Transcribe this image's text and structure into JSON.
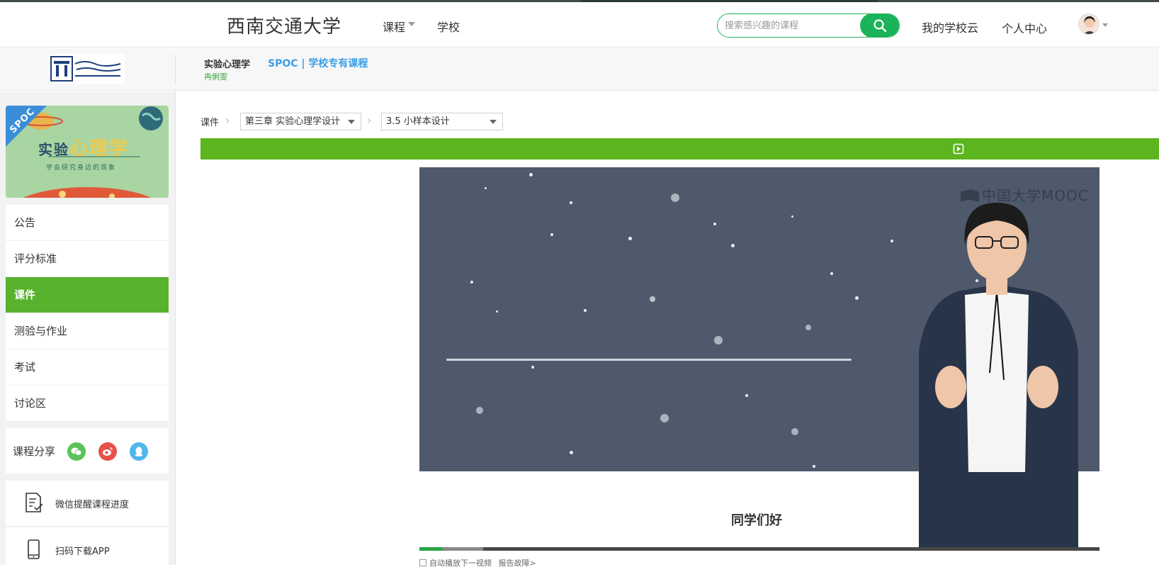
{
  "header": {
    "site_title": "西南交通大学",
    "nav_course": "课程",
    "nav_school": "学校",
    "search_placeholder": "搜索感兴趣的课程",
    "nav_cloud": "我的学校云",
    "nav_personal": "个人中心"
  },
  "course": {
    "name": "实验心理学",
    "badge": "SPOC | 学校专有课程",
    "teacher": "冉俐雯"
  },
  "banner": {
    "corner": "SPOC",
    "title_part1": "实验",
    "title_part2": "心理学",
    "subtitle": "学会研究身边的现象"
  },
  "sidebar": {
    "items": [
      {
        "label": "公告",
        "active": false
      },
      {
        "label": "评分标准",
        "active": false
      },
      {
        "label": "课件",
        "active": true
      },
      {
        "label": "测验与作业",
        "active": false
      },
      {
        "label": "考试",
        "active": false
      },
      {
        "label": "讨论区",
        "active": false
      }
    ],
    "share_label": "课程分享",
    "tool_wechat": "微信提醒课程进度",
    "tool_app": "扫码下载APP"
  },
  "breadcrumb": {
    "root": "课件",
    "chapter": "第三章 实验心理学设计",
    "section": "3.5 小样本设计"
  },
  "video": {
    "watermark": "中国大学MOOC",
    "subtitle": "同学们好",
    "played_fraction": 0.034,
    "buffered_fraction": 0.094
  },
  "player": {
    "autoplay_label": "自动播放下一视频",
    "report_label": "报告故障>"
  },
  "colors": {
    "accent_green": "#5cb41e",
    "active_menu": "#58b22d",
    "badge_blue": "#3a9ee8"
  }
}
